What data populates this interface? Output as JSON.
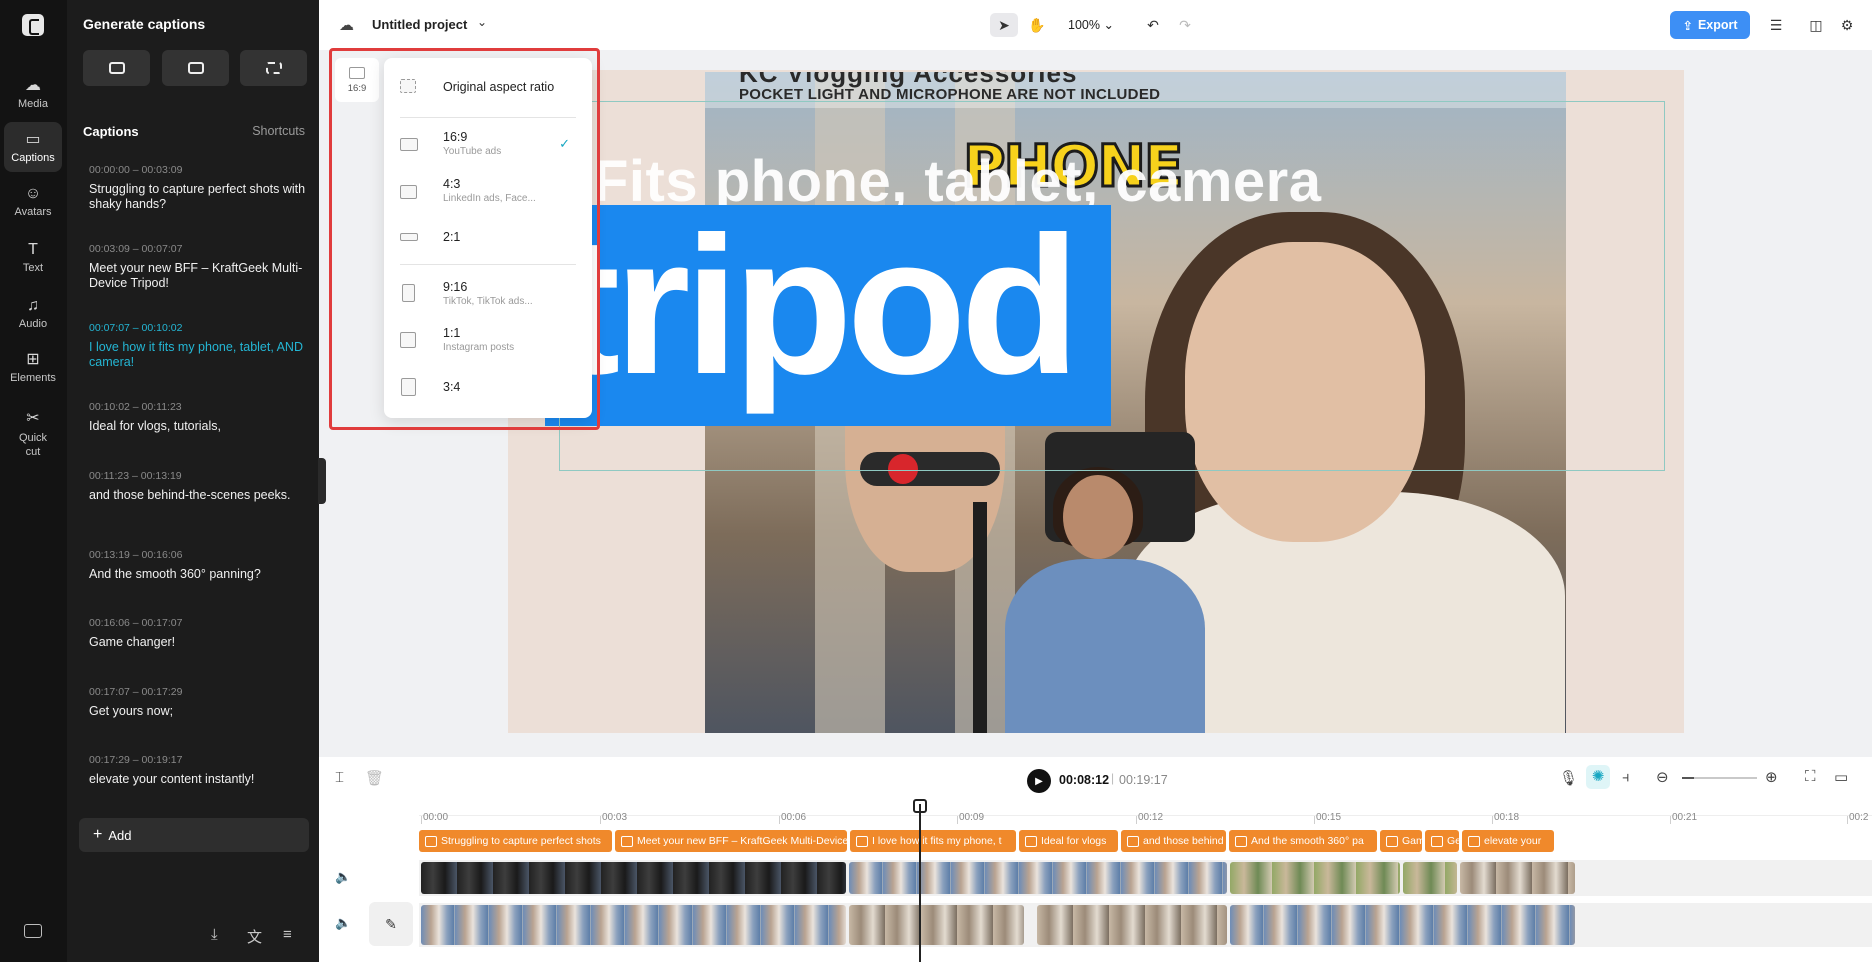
{
  "rail": {
    "items": [
      {
        "label": "Media",
        "icon": "media-icon"
      },
      {
        "label": "Captions",
        "icon": "captions-icon"
      },
      {
        "label": "Avatars",
        "icon": "avatars-icon"
      },
      {
        "label": "Text",
        "icon": "text-icon"
      },
      {
        "label": "Audio",
        "icon": "audio-icon"
      },
      {
        "label": "Elements",
        "icon": "elements-icon"
      },
      {
        "label": "Quick cut",
        "icon": "quick-cut-icon"
      }
    ]
  },
  "panel": {
    "title": "Generate captions",
    "captions_heading": "Captions",
    "shortcuts_label": "Shortcuts",
    "add_label": "Add",
    "captions": [
      {
        "time": "00:00:00 – 00:03:09",
        "text": "Struggling to capture perfect shots with shaky hands?"
      },
      {
        "time": "00:03:09 – 00:07:07",
        "text": "Meet your new BFF – KraftGeek Multi-Device Tripod!"
      },
      {
        "time": "00:07:07 – 00:10:02",
        "text": "I love how it fits my phone, tablet, AND camera!"
      },
      {
        "time": "00:10:02 – 00:11:23",
        "text": "Ideal for vlogs, tutorials,"
      },
      {
        "time": "00:11:23 – 00:13:19",
        "text": "and those behind-the-scenes peeks."
      },
      {
        "time": "00:13:19 – 00:16:06",
        "text": "And the smooth 360° panning?"
      },
      {
        "time": "00:16:06 – 00:17:07",
        "text": "Game changer!"
      },
      {
        "time": "00:17:07 – 00:17:29",
        "text": "Get yours now;"
      },
      {
        "time": "00:17:29 – 00:19:17",
        "text": "elevate your content instantly!"
      }
    ],
    "active_index": 2
  },
  "topbar": {
    "project_name": "Untitled project",
    "zoom": "100%",
    "export_label": "Export"
  },
  "canvas": {
    "top_text": "POCKET LIGHT AND MICROPHONE ARE NOT INCLUDED",
    "top_text_big": "KC Vlogging Accessories",
    "sticker": "PHONE",
    "overlay_line": "Fits phone, tablet, camera",
    "big_word": "tripod"
  },
  "aspect": {
    "current": "16:9",
    "options": [
      {
        "name": "Original aspect ratio",
        "sub": ""
      },
      {
        "name": "16:9",
        "sub": "YouTube ads",
        "selected": true
      },
      {
        "name": "4:3",
        "sub": "LinkedIn ads, Face..."
      },
      {
        "name": "2:1",
        "sub": ""
      },
      {
        "name": "9:16",
        "sub": "TikTok, TikTok ads..."
      },
      {
        "name": "1:1",
        "sub": "Instagram posts"
      },
      {
        "name": "3:4",
        "sub": ""
      }
    ]
  },
  "timeline": {
    "current_time": "00:08:12",
    "total_time": "00:19:17",
    "ruler": [
      "00:00",
      "00:03",
      "00:06",
      "00:09",
      "00:12",
      "00:15",
      "00:18",
      "00:21",
      "00:2"
    ],
    "caption_clips": [
      "Struggling to capture perfect shots",
      "Meet your new BFF – KraftGeek Multi-Device",
      "I love how it fits my phone, t",
      "Ideal for vlogs",
      "and those behind",
      "And the smooth 360° pa",
      "Game",
      "Ge",
      "elevate your"
    ]
  }
}
